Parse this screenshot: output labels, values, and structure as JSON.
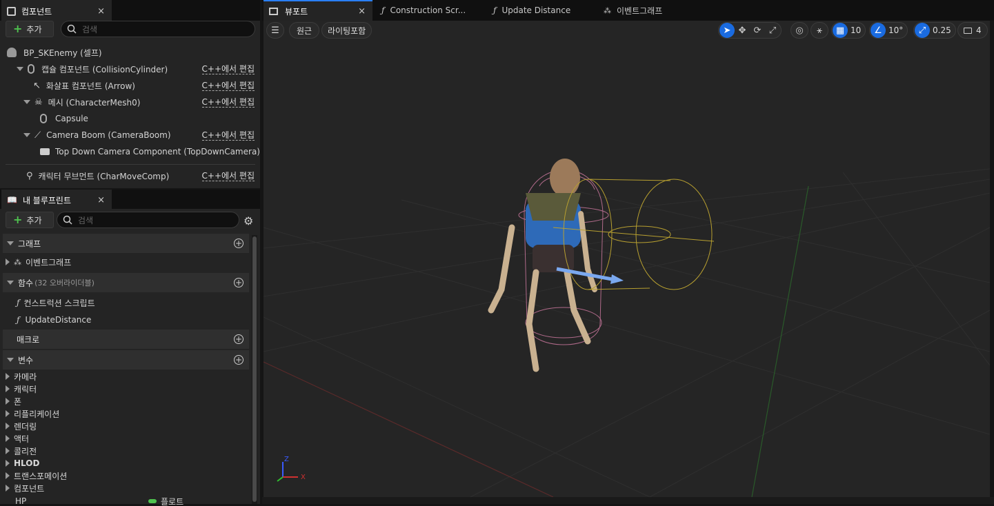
{
  "components_panel": {
    "title": "컴포넌트",
    "add_label": "추가",
    "search_placeholder": "검색",
    "root": "BP_SKEnemy (셀프)",
    "items": [
      {
        "label": "캡슐 컴포넌트 (CollisionCylinder)",
        "edit": "C++에서 편집"
      },
      {
        "label": "화살표 컴포넌트 (Arrow)",
        "edit": "C++에서 편집"
      },
      {
        "label": "메시 (CharacterMesh0)",
        "edit": "C++에서 편집"
      },
      {
        "label": "Capsule",
        "edit": ""
      },
      {
        "label": "Camera Boom (CameraBoom)",
        "edit": "C++에서 편집"
      },
      {
        "label": "Top Down Camera Component (TopDownCamera)",
        "edit": ""
      },
      {
        "label": "캐릭터 무브먼트 (CharMoveComp)",
        "edit": "C++에서 편집"
      }
    ]
  },
  "blueprint_panel": {
    "title": "내 블루프린트",
    "add_label": "추가",
    "search_placeholder": "검색",
    "graph_section": "그래프",
    "event_graph": "이벤트그래프",
    "functions_section": "함수",
    "functions_overrides": "(32 오버라이더블)",
    "construction_script": "컨스트럭션 스크립트",
    "update_distance": "UpdateDistance",
    "macros_section": "매크로",
    "variables_section": "변수",
    "variable_categories": [
      "카메라",
      "캐릭터",
      "폰",
      "리플리케이션",
      "렌더링",
      "액터",
      "콜리전",
      "HLOD",
      "트랜스포메이션",
      "컴포넌트"
    ],
    "partial_var_name": "HP",
    "partial_var_type": "플로트"
  },
  "tabs": [
    {
      "label": "뷰포트"
    },
    {
      "label": "Construction Scr..."
    },
    {
      "label": "Update Distance"
    },
    {
      "label": "이벤트그래프"
    }
  ],
  "viewport_toolbar": {
    "perspective_label": "원근",
    "lighting_label": "라이팅포함",
    "grid_snap": "10",
    "rotation_snap": "10°",
    "scale_snap": "0.25",
    "camera_speed": "4"
  },
  "axis_labels": {
    "x": "X",
    "z": "Z"
  },
  "colors": {
    "accent": "#2a7fff",
    "toggle_on": "#1a6be0",
    "add_green": "#4fc24f"
  }
}
